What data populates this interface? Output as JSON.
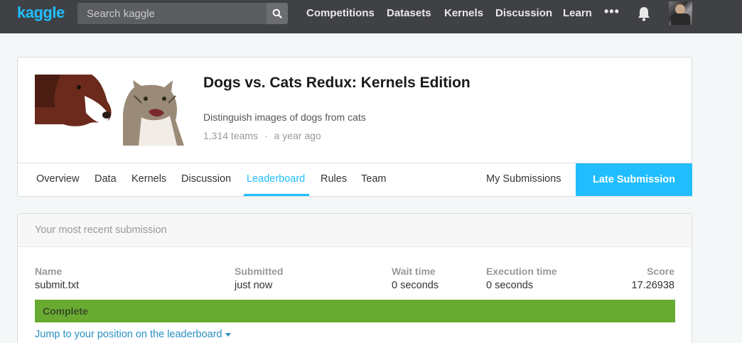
{
  "topbar": {
    "logo": "kaggle",
    "search_placeholder": "Search kaggle",
    "nav": [
      "Competitions",
      "Datasets",
      "Kernels",
      "Discussion",
      "Learn"
    ],
    "more": "•••"
  },
  "competition": {
    "title": "Dogs vs. Cats Redux: Kernels Edition",
    "subtitle": "Distinguish images of dogs from cats",
    "teams": "1,314 teams",
    "separator": "·",
    "age": "a year ago"
  },
  "tabs": {
    "items": [
      "Overview",
      "Data",
      "Kernels",
      "Discussion",
      "Leaderboard",
      "Rules",
      "Team"
    ],
    "active": "Leaderboard",
    "my_submissions": "My Submissions",
    "late_submission": "Late Submission"
  },
  "submission": {
    "heading": "Your most recent submission",
    "columns": {
      "name": "Name",
      "submitted": "Submitted",
      "wait": "Wait time",
      "exec": "Execution time",
      "score": "Score"
    },
    "values": {
      "name": "submit.txt",
      "submitted": "just now",
      "wait": "0 seconds",
      "exec": "0 seconds",
      "score": "17.26938"
    },
    "status": "Complete",
    "jump_link": "Jump to your position on the leaderboard"
  },
  "colors": {
    "brand": "#20beff",
    "status_complete": "#69ab31",
    "topbar": "#3f4145"
  }
}
